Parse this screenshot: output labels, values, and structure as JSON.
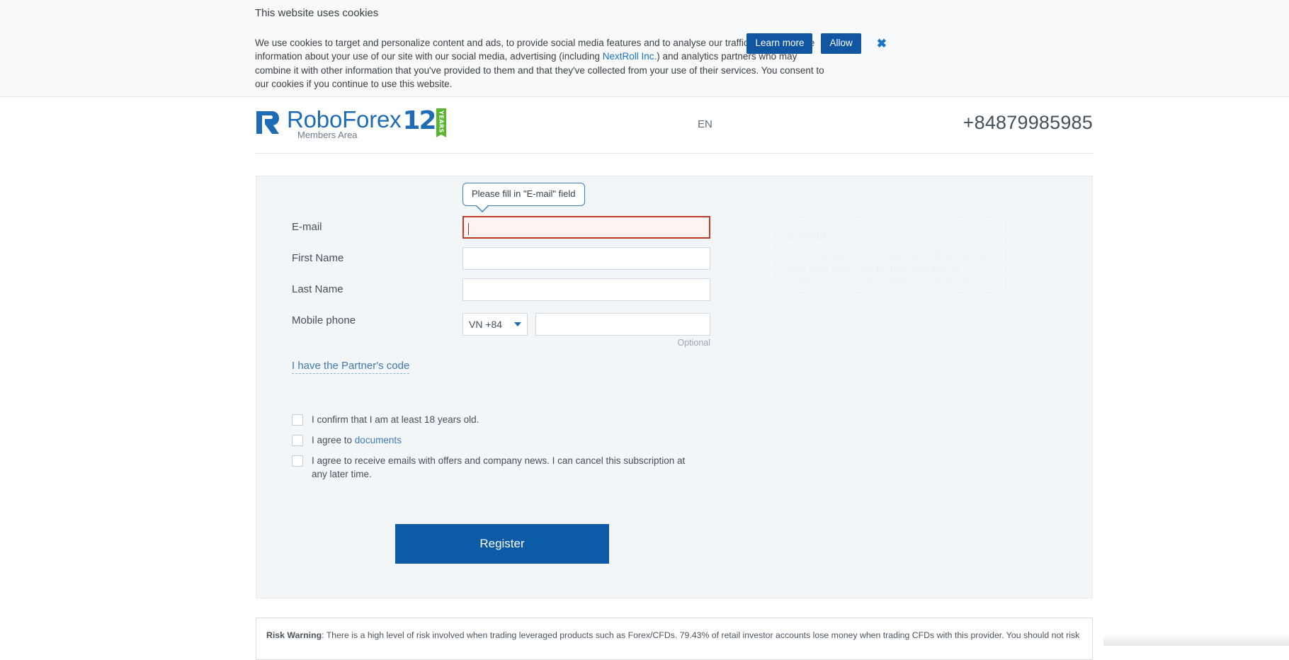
{
  "cookie_banner": {
    "title": "This website uses cookies",
    "body_part1": "We use cookies to target and personalize content and ads, to provide social media features and to analyse our traffic. We also share information about your use of our site with our social media, advertising (including ",
    "body_link": "NextRoll Inc.",
    "body_part2": ") and analytics partners who may combine it with other information that you've provided to them and that they've collected from your use of their services. You consent to our cookies if you continue to use this website.",
    "learn_more_label": "Learn more",
    "allow_label": "Allow",
    "close_label": "✖",
    "button_color": "#1156a3"
  },
  "header": {
    "logo_text": "RoboForex",
    "logo_subtitle": "Members Area",
    "anniversary_number": "12",
    "anniversary_ribbon": "YEARS",
    "language": "EN",
    "phone": "+84879985985",
    "brand_blue": "#1f6cb5",
    "brand_green": "#5cb531"
  },
  "form": {
    "tooltip": "Please fill in \"E-mail\" field",
    "fields": [
      {
        "label": "E-mail",
        "value": "",
        "state": "error"
      },
      {
        "label": "First Name",
        "value": "",
        "state": "normal"
      },
      {
        "label": "Last Name",
        "value": "",
        "state": "normal"
      },
      {
        "label": "Mobile phone",
        "value": "",
        "state": "normal"
      }
    ],
    "country_code": "VN +84",
    "phone_optional_note": "Optional",
    "partner_code_link": "I have the Partner's code",
    "checkboxes": [
      {
        "text": "I confirm that I am at least 18 years old.",
        "checked": false
      },
      {
        "text_before": "I agree to ",
        "link": "documents",
        "checked": false
      },
      {
        "text": "I agree to receive emails with offers and company news. I can cancel this subscription at any later time.",
        "checked": false
      }
    ],
    "submit_label": "Register",
    "submit_color": "#0b5ba6",
    "error_border_color": "#c0392b"
  },
  "hint_panel": {
    "title": "E-mail",
    "body": "The email address you specified will be used as your login code, and for receiving emails enabling you to confirm balance operations."
  },
  "risk_warning": {
    "prefix": "Risk Warning",
    "text": ": There is a high level of risk involved when trading leveraged products such as Forex/CFDs. 79.43% of retail investor accounts lose money when trading CFDs with this provider. You should not risk more than"
  }
}
